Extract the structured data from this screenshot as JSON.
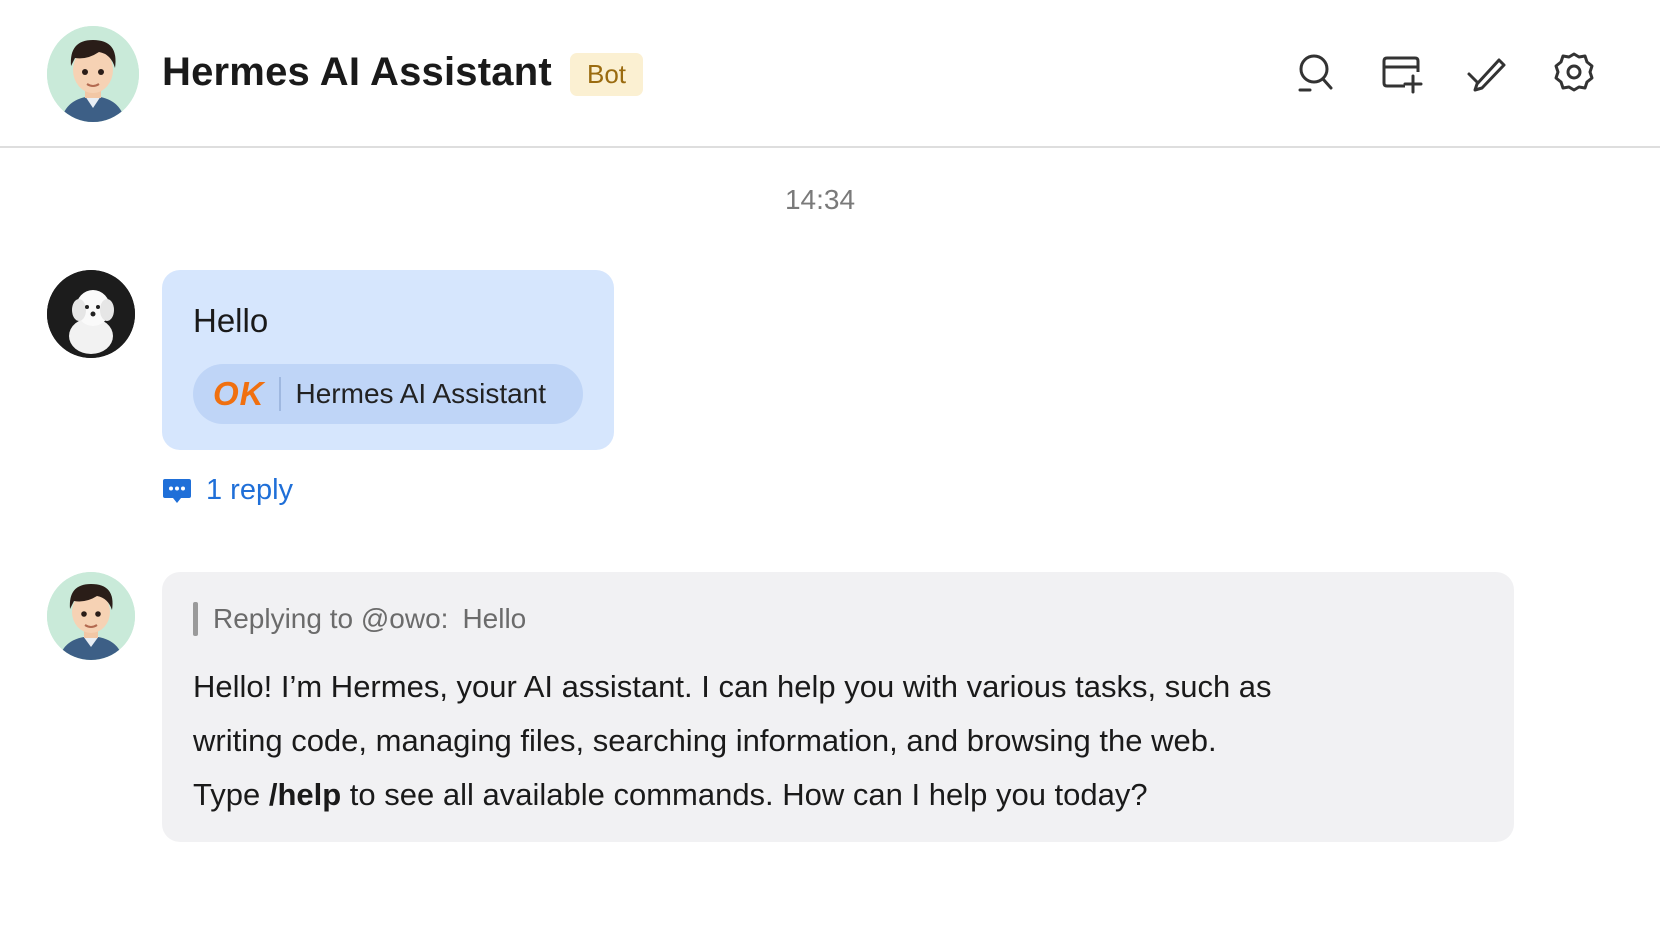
{
  "header": {
    "title": "Hermes AI Assistant",
    "badge": "Bot",
    "icons": [
      "search-icon",
      "new-window-icon",
      "edit-icon",
      "settings-icon"
    ]
  },
  "conversation": {
    "timestamp": "14:34",
    "messages": [
      {
        "sender": "owo",
        "avatar": "dog-avatar",
        "text": "Hello",
        "reaction": {
          "emoji_label": "OK",
          "by": "Hermes AI Assistant"
        },
        "reply_count_label": "1 reply"
      },
      {
        "sender": "Hermes AI Assistant",
        "avatar": "bot-avatar",
        "quote": {
          "prefix": "Replying to @owo:",
          "text": "Hello"
        },
        "body": {
          "line1": "Hello! I’m Hermes, your AI assistant. I can help you with various tasks, such as",
          "line2": "writing code, managing files, searching information, and browsing the web.",
          "line3_prefix": "Type ",
          "line3_command": "/help",
          "line3_suffix": " to see all available commands. How can I help you today?"
        }
      }
    ]
  },
  "colors": {
    "user_bubble": "#d6e6fd",
    "bot_bubble": "#f1f1f3",
    "link": "#1f6fd8",
    "badge_bg": "#fbf0d2",
    "badge_text": "#9a6b10",
    "ok_emoji": "#f07010"
  }
}
